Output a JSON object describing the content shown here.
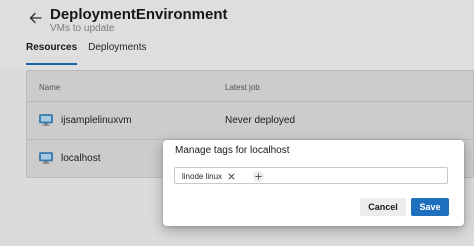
{
  "header": {
    "title": "DeploymentEnvironment",
    "subtitle": "VMs to update",
    "back_icon": "arrow-left-icon"
  },
  "tabs": [
    {
      "label": "Resources",
      "active": true
    },
    {
      "label": "Deployments",
      "active": false
    }
  ],
  "table": {
    "columns": [
      "Name",
      "Latest job"
    ],
    "rows": [
      {
        "name": "ijsamplelinuxvm",
        "latest_job": "Never deployed",
        "icon": "virtual-machine-icon"
      },
      {
        "name": "localhost",
        "latest_job": "",
        "icon": "virtual-machine-icon"
      }
    ]
  },
  "dialog": {
    "title": "Manage tags for localhost",
    "tags": [
      "linode linux"
    ],
    "remove_icon": "close-icon",
    "add_icon": "plus-icon",
    "cancel_label": "Cancel",
    "save_label": "Save"
  },
  "colors": {
    "accent": "#1f6fbf",
    "vm_icon": "#3a8fd0"
  }
}
